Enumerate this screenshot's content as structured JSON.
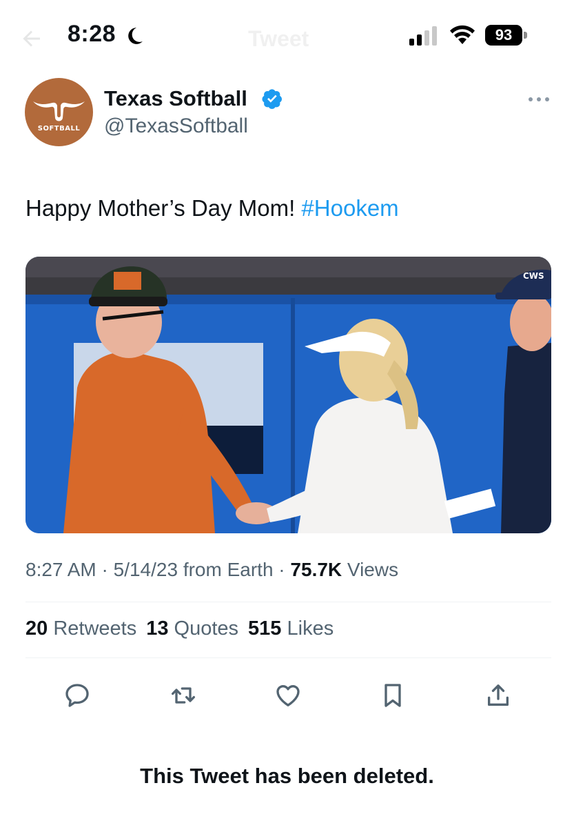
{
  "status_bar": {
    "time": "8:28",
    "battery": "93",
    "faint_title": "Tweet"
  },
  "tweet": {
    "author": {
      "display_name": "Texas Softball",
      "handle": "@TexasSoftball",
      "avatar_text": "SOFTBALL",
      "verified": true
    },
    "text": "Happy Mother’s Day Mom!",
    "hashtag": "#Hookem",
    "photo_caption_cap": "CWS",
    "meta": {
      "time": "8:27 AM",
      "sep1": " · ",
      "date": "5/14/23",
      "source": " from Earth",
      "sep2": " · ",
      "views_count": "75.7K",
      "views_label": " Views"
    },
    "stats": {
      "retweets_count": "20",
      "retweets_label": " Retweets",
      "quotes_count": "13",
      "quotes_label": " Quotes",
      "likes_count": "515",
      "likes_label": " Likes"
    }
  },
  "actions": [
    "reply-icon",
    "retweet-icon",
    "like-icon",
    "bookmark-icon",
    "share-icon"
  ],
  "deleted_notice": "This Tweet has been deleted.",
  "colors": {
    "accent": "#1d9bf0",
    "secondary_text": "#536471",
    "burnt_orange": "#bf5700"
  }
}
